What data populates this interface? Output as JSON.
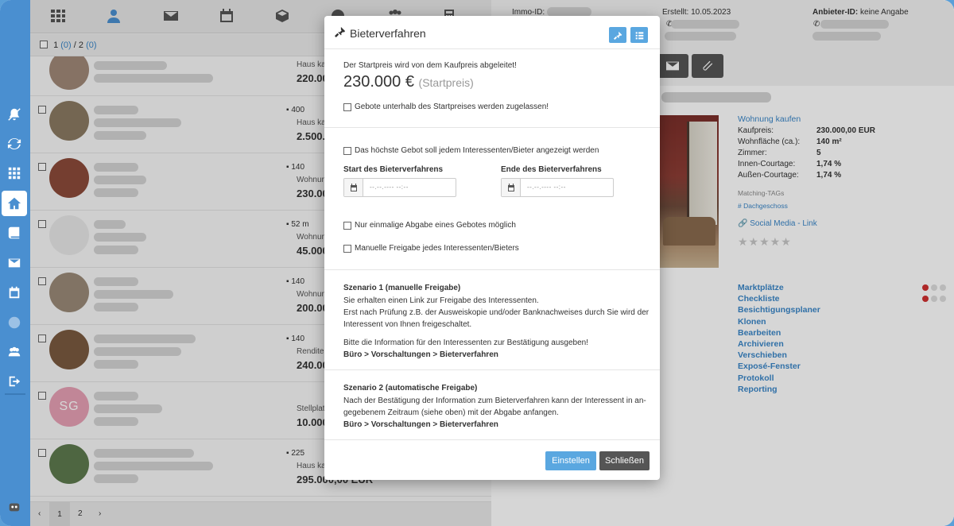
{
  "list": {
    "select_count": "1",
    "select_count_sel": "(0)",
    "select_sep": "/",
    "select_total": "2",
    "select_total_sel": "(0)",
    "rows": [
      {
        "meta1": "",
        "meta2": "Haus ka",
        "meta3": "220.00"
      },
      {
        "meta1": "400",
        "meta2": "Haus ka",
        "meta3": "2.500."
      },
      {
        "meta1": "140",
        "meta2": "Wohnun",
        "meta3": "230.00"
      },
      {
        "meta1": "52 m",
        "meta2": "Wohnun",
        "meta3": "45.000"
      },
      {
        "meta1": "140",
        "meta2": "Wohnun",
        "meta3": "200.00"
      },
      {
        "meta1": "140",
        "meta2": "Rendite",
        "meta3": "240.00"
      },
      {
        "meta1": "",
        "meta2": "Stellplat",
        "meta3": "10.000",
        "avatar": "SG"
      },
      {
        "meta1": "225",
        "meta2": "Haus ka",
        "meta3": "295.000,00 EUR"
      }
    ],
    "pager": {
      "prev": "‹",
      "page1": "1",
      "page2": "2",
      "next": "›"
    }
  },
  "detail": {
    "immo_label": "Immo-ID:",
    "created": "Erstellt: 10.05.2023",
    "provider_label": "Anbieter-ID:",
    "provider_value": "keine Angabe",
    "type_link": "Wohnung kaufen",
    "props": [
      {
        "k": "Kaufpreis:",
        "v": "230.000,00 EUR"
      },
      {
        "k": "Wohnfläche (ca.):",
        "v": "140 m²"
      },
      {
        "k": "Zimmer:",
        "v": "5"
      },
      {
        "k": "Innen-Courtage:",
        "v": "1,74 %"
      },
      {
        "k": "Außen-Courtage:",
        "v": "1,74 %"
      }
    ],
    "matching_label": "Matching-TAGs",
    "tag": "# Dachgeschoss",
    "social_link": "Social Media - Link",
    "stars": "★★★★★",
    "links": [
      "Marktplätze",
      "Checkliste",
      "Besichtigungsplaner",
      "Klonen",
      "Bearbeiten",
      "Archivieren",
      "Verschieben",
      "Exposé-Fenster",
      "Protokoll",
      "Reporting"
    ]
  },
  "modal": {
    "title": "Bieterverfahren",
    "intro": "Der Startpreis wird von dem Kaufpreis abgeleitet!",
    "price": "230.000 €",
    "price_suffix": "(Startpreis)",
    "cb_below_start": "Gebote unterhalb des Startpreises werden zugelassen!",
    "cb_show_highest": "Das höchste Gebot soll jedem Interessenten/Bieter angezeigt werden",
    "start_label": "Start des Bieterverfahrens",
    "end_label": "Ende des Bieterverfahrens",
    "date_placeholder": "--.--.---- --:--",
    "cb_single_bid": "Nur einmalige Abgabe eines Gebotes möglich",
    "cb_manual_release": "Manuelle Freigabe jedes Interessenten/Bieters",
    "s1_title": "Szenario 1 (manuelle Freigabe)",
    "s1_line1": "Sie erhalten einen Link zur Freigabe des Interessenten.",
    "s1_line2": "Erst nach Prüfung z.B. der Ausweiskopie und/oder Banknachweises durch Sie wird der",
    "s1_line3": "Interessent von Ihnen freigeschaltet.",
    "s1_line4": "Bitte die Information für den Interessenten zur Bestätigung ausgeben!",
    "s1_path": "Büro > Vorschaltungen > Bieterverfahren",
    "s2_title": "Szenario 2 (automatische Freigabe)",
    "s2_line1": "Nach der Bestätigung der Information zum Bieterverfahren kann der Interessent in an-",
    "s2_line2": "gegebenem Zeitraum (siehe oben) mit der Abgabe anfangen.",
    "s2_path": "Büro > Vorschaltungen > Bieterverfahren",
    "btn_set": "Einstellen",
    "btn_close": "Schließen"
  },
  "colors": {
    "accent": "#5aa7e0",
    "sidebar": "#4a8fd0",
    "dark_button": "#555555",
    "red_dot": "#d03030"
  }
}
